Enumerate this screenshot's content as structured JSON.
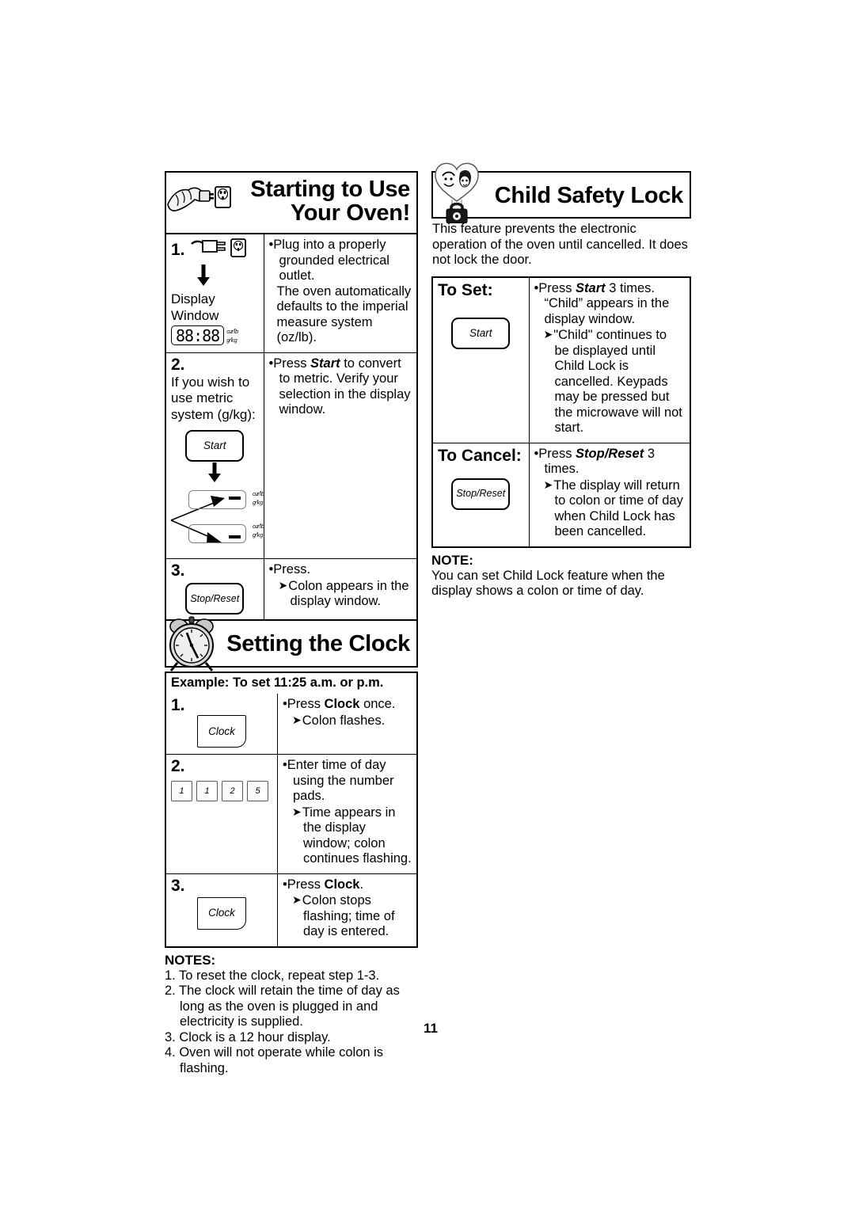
{
  "page": {
    "number": "11"
  },
  "starting_to_use": {
    "title": "Starting to Use\nYour Oven!",
    "icon": "hand-plug-outlet-icon",
    "steps": [
      {
        "number": "1.",
        "left_label": "Display Window",
        "display_value": "88:88",
        "unit_imperial_num": "oz",
        "unit_imperial_den": "lb",
        "unit_metric_num": "g",
        "unit_metric_den": "kg",
        "right_bullet": "Plug into a properly grounded electrical outlet.",
        "right_extra": "The oven automatically defaults to the imperial measure system (oz/lb)."
      },
      {
        "number": "2.",
        "left_text": "If you wish to use metric system (g/kg):",
        "key_label": "Start",
        "right_bullet_pre": "Press ",
        "right_bullet_bold": "Start",
        "right_bullet_post": " to convert to metric. Verify your selection in the display window."
      },
      {
        "number": "3.",
        "key_label": "Stop/Reset",
        "right_bullet": "Press.",
        "right_sub": "Colon appears in the display window."
      }
    ]
  },
  "child_safety_lock": {
    "title": "Child Safety Lock",
    "icon": "heart-children-padlock-icon",
    "intro": "This feature prevents the electronic operation of the oven until cancelled. It does not lock the door.",
    "rows": [
      {
        "label": "To Set:",
        "key_label": "Start",
        "bullet_pre": "Press ",
        "bullet_bold": "Start",
        "bullet_post": " 3 times. “Child” appears in the display window.",
        "sub": "\"Child\" continues to be displayed until Child Lock is cancelled. Keypads may be pressed but the microwave will not start."
      },
      {
        "label": "To Cancel:",
        "key_label": "Stop/Reset",
        "bullet_pre": "Press ",
        "bullet_bold": "Stop/Reset",
        "bullet_post": " 3 times.",
        "sub": "The display will return to colon or time of day when Child Lock has been cancelled."
      }
    ],
    "note_header": "NOTE:",
    "note_body": "You can set Child Lock feature when the display shows a colon or time of day."
  },
  "setting_the_clock": {
    "title": "Setting the Clock",
    "icon": "alarm-clock-icon",
    "example": "Example: To set 11:25 a.m. or p.m.",
    "steps": [
      {
        "number": "1.",
        "key_label": "Clock",
        "bullet_pre": "Press ",
        "bullet_bold": "Clock",
        "bullet_post": " once.",
        "sub": "Colon flashes."
      },
      {
        "number": "2.",
        "number_pads": [
          "1",
          "1",
          "2",
          "5"
        ],
        "bullet": "Enter time of day using the number pads.",
        "sub": "Time appears in the display window; colon continues flashing."
      },
      {
        "number": "3.",
        "key_label": "Clock",
        "bullet_pre": "Press ",
        "bullet_bold": "Clock",
        "bullet_post": ".",
        "sub": "Colon stops flashing; time of day is entered."
      }
    ],
    "notes_header": "NOTES:",
    "notes": [
      "1. To reset the clock, repeat step 1-3.",
      "2. The clock will retain the time of day as long as the oven is plugged in and electricity is supplied.",
      "3. Clock is a 12 hour display.",
      "4. Oven will not operate while colon is flashing."
    ]
  },
  "glyphs": {
    "bullet": "•",
    "arrow": "➤"
  }
}
